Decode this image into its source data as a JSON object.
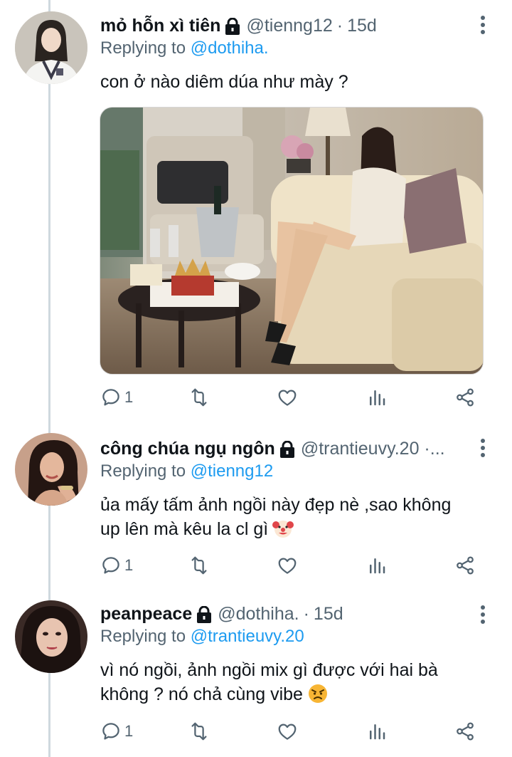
{
  "tweets": [
    {
      "display_name": "mỏ hỗn xì tiên",
      "handle": "@tienng12",
      "dot": "·",
      "time": "15d",
      "replying_prefix": "Replying to",
      "replying_to": "@dothiha.",
      "text": "con ở nào diêm dúa như mày ?",
      "text_2": "",
      "reply_count": "1",
      "avatar_icon": "avatar-photo"
    },
    {
      "display_name": "công chúa ngụ ngôn",
      "handle": "@trantieuvy.20 ·...",
      "dot": "",
      "time": "",
      "replying_prefix": "Replying to",
      "replying_to": "@tienng12",
      "text": "ủa mấy tấm ảnh ngồi này đẹp nè ,sao không",
      "text_2": "up lên mà kêu la cl gì",
      "reply_count": "1",
      "avatar_icon": "avatar-photo"
    },
    {
      "display_name": "peanpeace",
      "handle": "@dothiha.",
      "dot": "·",
      "time": "15d",
      "replying_prefix": "Replying to",
      "replying_to": "@trantieuvy.20",
      "text": "vì nó ngồi, ảnh ngồi mix gì được với hai bà",
      "text_2": "không ? nó chả cùng vibe",
      "reply_count": "1",
      "avatar_icon": "avatar-photo"
    }
  ],
  "icons": {
    "reply": "reply-icon",
    "retweet": "retweet-icon",
    "like": "heart-icon",
    "views": "views-icon",
    "share": "share-icon",
    "lock": "lock-icon",
    "more": "more-options-icon",
    "clown": "clown-emoji",
    "angry": "angry-emoji"
  },
  "colors": {
    "link": "#1d9bf0",
    "secondary_text": "#536471",
    "thread_line": "#cfd9de"
  }
}
